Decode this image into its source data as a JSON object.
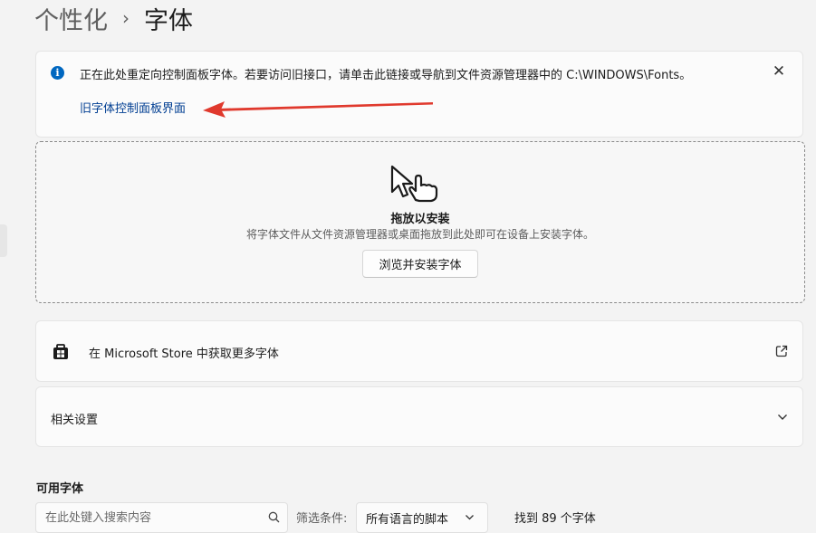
{
  "breadcrumb": {
    "parent": "个性化",
    "separator": "›",
    "current": "字体"
  },
  "info_banner": {
    "icon": "info-icon",
    "message": "正在此处重定向控制面板字体。若要访问旧接口，请单击此链接或导航到文件资源管理器中的 C:\\WINDOWS\\Fonts。",
    "link": "旧字体控制面板界面",
    "close_icon": "close-icon"
  },
  "drop_zone": {
    "icon": "drag-hand-icon",
    "title": "拖放以安装",
    "description": "将字体文件从文件资源管理器或桌面拖放到此处即可在设备上安装字体。",
    "browse_button": "浏览并安装字体"
  },
  "store": {
    "icon": "store-icon",
    "label": "在 Microsoft Store 中获取更多字体",
    "external_icon": "external-link-icon"
  },
  "related": {
    "label": "相关设置",
    "chevron_icon": "chevron-down-icon"
  },
  "available_fonts": {
    "label": "可用字体",
    "search_placeholder": "在此处键入搜索内容",
    "filter_label": "筛选条件:",
    "filter_value": "所有语言的脚本",
    "found_count": "找到 89 个字体"
  },
  "colors": {
    "accent": "#0067c0",
    "link": "#003e92",
    "annotation_arrow": "#e0392d",
    "background": "#f3f3f3",
    "card": "#fbfbfb"
  }
}
